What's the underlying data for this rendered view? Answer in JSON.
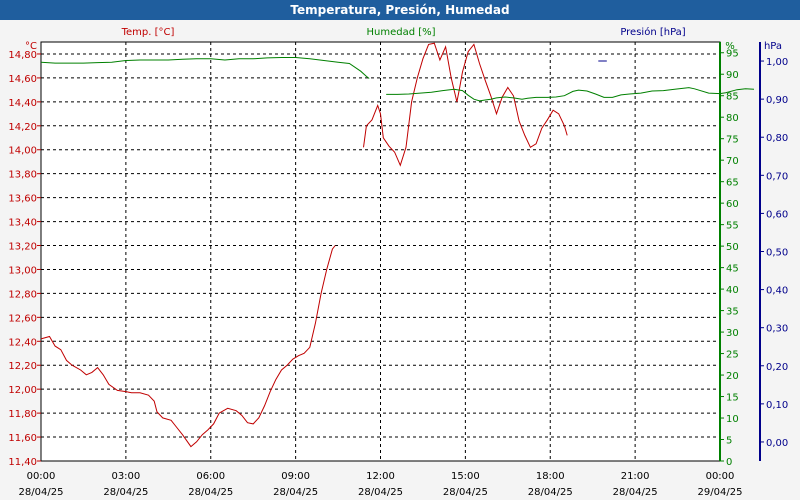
{
  "window": {
    "title": "Temperatura, Presión, Humedad"
  },
  "colors": {
    "temperature": "#c00000",
    "humidity": "#008000",
    "pressure": "#00008b",
    "grid": "#000000",
    "title_bar": "#1f5e9e"
  },
  "chart_data": {
    "type": "line",
    "title": "Temperatura, Presión, Humedad",
    "grid": true,
    "x_ticks": [
      {
        "time": "00:00",
        "date": "28/04/25"
      },
      {
        "time": "03:00",
        "date": "28/04/25"
      },
      {
        "time": "06:00",
        "date": "28/04/25"
      },
      {
        "time": "09:00",
        "date": "28/04/25"
      },
      {
        "time": "12:00",
        "date": "28/04/25"
      },
      {
        "time": "15:00",
        "date": "28/04/25"
      },
      {
        "time": "18:00",
        "date": "28/04/25"
      },
      {
        "time": "21:00",
        "date": "28/04/25"
      },
      {
        "time": "00:00",
        "date": "29/04/25"
      }
    ],
    "x_range_hours": [
      0,
      24
    ],
    "axes": {
      "temperature": {
        "label": "Temp. [°C]",
        "unit": "°C",
        "range": [
          11.4,
          14.9
        ],
        "ticks": [
          "11,40",
          "11,60",
          "11,80",
          "12,00",
          "12,20",
          "12,40",
          "12,60",
          "12,80",
          "13,00",
          "13,20",
          "13,40",
          "13,60",
          "13,80",
          "14,00",
          "14,20",
          "14,40",
          "14,60",
          "14,80"
        ]
      },
      "humidity": {
        "label": "Humedad [%]",
        "unit": "%",
        "range": [
          0,
          97.5
        ],
        "ticks": [
          "0",
          "5",
          "10",
          "15",
          "20",
          "25",
          "30",
          "35",
          "40",
          "45",
          "50",
          "55",
          "60",
          "65",
          "70",
          "75",
          "80",
          "85",
          "90",
          "95"
        ]
      },
      "pressure": {
        "label": "Presión [hPa]",
        "unit": "hPa",
        "range": [
          -0.05,
          1.05
        ],
        "ticks": [
          "0,00",
          "0,10",
          "0,20",
          "0,30",
          "0,40",
          "0,50",
          "0,60",
          "0,70",
          "0,80",
          "0,90",
          "1,00"
        ]
      }
    },
    "series": [
      {
        "name": "Temp. [°C]",
        "axis": "temperature",
        "segments": [
          [
            [
              0,
              12.42
            ],
            [
              0.3,
              12.44
            ],
            [
              0.5,
              12.36
            ],
            [
              0.7,
              12.33
            ],
            [
              0.9,
              12.24
            ],
            [
              1.1,
              12.2
            ],
            [
              1.4,
              12.16
            ],
            [
              1.6,
              12.12
            ],
            [
              1.8,
              12.14
            ],
            [
              2.0,
              12.18
            ],
            [
              2.2,
              12.12
            ],
            [
              2.4,
              12.04
            ],
            [
              2.7,
              11.99
            ],
            [
              3.0,
              11.98
            ],
            [
              3.2,
              11.97
            ],
            [
              3.5,
              11.97
            ],
            [
              3.8,
              11.95
            ],
            [
              4.0,
              11.9
            ],
            [
              4.1,
              11.81
            ],
            [
              4.3,
              11.76
            ],
            [
              4.6,
              11.74
            ],
            [
              4.8,
              11.68
            ],
            [
              5.0,
              11.62
            ],
            [
              5.3,
              11.52
            ],
            [
              5.5,
              11.56
            ],
            [
              5.7,
              11.62
            ],
            [
              5.9,
              11.66
            ],
            [
              6.1,
              11.71
            ],
            [
              6.3,
              11.8
            ],
            [
              6.6,
              11.84
            ],
            [
              6.9,
              11.82
            ],
            [
              7.1,
              11.78
            ],
            [
              7.3,
              11.72
            ],
            [
              7.5,
              11.71
            ],
            [
              7.7,
              11.76
            ],
            [
              7.9,
              11.86
            ],
            [
              8.1,
              11.98
            ],
            [
              8.3,
              12.08
            ],
            [
              8.5,
              12.16
            ],
            [
              8.7,
              12.2
            ],
            [
              8.9,
              12.25
            ],
            [
              9.1,
              12.28
            ],
            [
              9.3,
              12.3
            ],
            [
              9.5,
              12.35
            ],
            [
              9.7,
              12.55
            ],
            [
              9.9,
              12.8
            ],
            [
              10.1,
              13.0
            ],
            [
              10.3,
              13.17
            ],
            [
              10.4,
              13.2
            ]
          ],
          [
            [
              11.4,
              14.02
            ],
            [
              11.5,
              14.2
            ],
            [
              11.7,
              14.25
            ],
            [
              11.9,
              14.37
            ],
            [
              12.0,
              14.3
            ],
            [
              12.1,
              14.1
            ],
            [
              12.3,
              14.03
            ],
            [
              12.5,
              13.98
            ],
            [
              12.7,
              13.87
            ],
            [
              12.9,
              14.02
            ],
            [
              13.1,
              14.4
            ],
            [
              13.3,
              14.6
            ],
            [
              13.5,
              14.76
            ],
            [
              13.7,
              14.88
            ],
            [
              13.9,
              14.89
            ],
            [
              14.1,
              14.75
            ],
            [
              14.3,
              14.86
            ],
            [
              14.5,
              14.6
            ],
            [
              14.7,
              14.4
            ],
            [
              14.8,
              14.52
            ],
            [
              14.9,
              14.65
            ],
            [
              15.1,
              14.82
            ],
            [
              15.3,
              14.88
            ],
            [
              15.5,
              14.72
            ],
            [
              15.7,
              14.58
            ],
            [
              15.9,
              14.45
            ],
            [
              16.1,
              14.3
            ],
            [
              16.3,
              14.44
            ],
            [
              16.5,
              14.52
            ],
            [
              16.7,
              14.45
            ],
            [
              16.9,
              14.24
            ],
            [
              17.1,
              14.12
            ],
            [
              17.3,
              14.02
            ],
            [
              17.5,
              14.05
            ],
            [
              17.7,
              14.18
            ],
            [
              17.9,
              14.25
            ],
            [
              18.1,
              14.33
            ],
            [
              18.3,
              14.3
            ],
            [
              18.5,
              14.2
            ],
            [
              18.6,
              14.12
            ]
          ]
        ]
      },
      {
        "name": "Humedad [%]",
        "axis": "humidity",
        "segments": [
          [
            [
              0,
              92.8
            ],
            [
              0.5,
              92.6
            ],
            [
              1,
              92.6
            ],
            [
              1.5,
              92.6
            ],
            [
              2,
              92.7
            ],
            [
              2.5,
              92.8
            ],
            [
              3,
              93.2
            ],
            [
              3.5,
              93.3
            ],
            [
              4,
              93.3
            ],
            [
              4.5,
              93.3
            ],
            [
              5,
              93.5
            ],
            [
              5.5,
              93.6
            ],
            [
              6,
              93.6
            ],
            [
              6.5,
              93.3
            ],
            [
              7,
              93.6
            ],
            [
              7.5,
              93.6
            ],
            [
              8,
              93.8
            ],
            [
              8.5,
              93.9
            ],
            [
              9,
              93.9
            ],
            [
              9.5,
              93.6
            ],
            [
              10,
              93.2
            ],
            [
              10.5,
              92.8
            ],
            [
              10.9,
              92.5
            ],
            [
              11.3,
              90.7
            ],
            [
              11.5,
              89.5
            ],
            [
              11.6,
              89.0
            ]
          ],
          [
            [
              12.2,
              85.3
            ],
            [
              12.6,
              85.3
            ],
            [
              13.0,
              85.4
            ],
            [
              13.4,
              85.6
            ],
            [
              13.8,
              85.8
            ],
            [
              14.2,
              86.2
            ],
            [
              14.6,
              86.5
            ],
            [
              14.9,
              86.2
            ],
            [
              15.1,
              85.1
            ],
            [
              15.3,
              84.2
            ],
            [
              15.5,
              83.8
            ],
            [
              15.7,
              84.0
            ],
            [
              15.9,
              84.2
            ],
            [
              16.1,
              84.5
            ],
            [
              16.4,
              84.7
            ],
            [
              16.7,
              84.5
            ],
            [
              17.0,
              84.2
            ],
            [
              17.2,
              84.4
            ],
            [
              17.5,
              84.6
            ],
            [
              17.9,
              84.6
            ],
            [
              18.2,
              84.7
            ],
            [
              18.5,
              85.0
            ],
            [
              18.8,
              86.0
            ],
            [
              19.0,
              86.3
            ],
            [
              19.3,
              86.1
            ],
            [
              19.6,
              85.4
            ],
            [
              19.9,
              84.6
            ],
            [
              20.2,
              84.6
            ],
            [
              20.5,
              85.2
            ],
            [
              20.8,
              85.4
            ],
            [
              21.2,
              85.6
            ],
            [
              21.6,
              86.1
            ],
            [
              22.0,
              86.2
            ],
            [
              22.4,
              86.5
            ],
            [
              22.9,
              86.9
            ],
            [
              23.1,
              86.6
            ],
            [
              23.6,
              85.6
            ],
            [
              24.0,
              85.5
            ],
            [
              24.2,
              85.7
            ],
            [
              24.6,
              86.4
            ],
            [
              24.9,
              86.6
            ],
            [
              25.2,
              86.5
            ]
          ]
        ]
      },
      {
        "name": "Presión [hPa]",
        "axis": "pressure",
        "segments": [
          [
            [
              19.7,
              1.0
            ],
            [
              20.0,
              1.0
            ]
          ]
        ]
      }
    ]
  }
}
